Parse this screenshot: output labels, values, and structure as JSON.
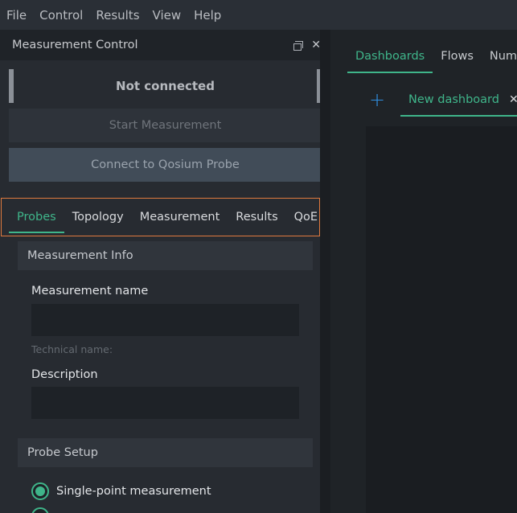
{
  "menu": [
    "File",
    "Control",
    "Results",
    "View",
    "Help"
  ],
  "panel": {
    "title": "Measurement Control",
    "status": "Not connected",
    "start_button": "Start Measurement",
    "connect_button": "Connect to Qosium Probe"
  },
  "tabs": {
    "items": [
      "Probes",
      "Topology",
      "Measurement",
      "Results",
      "QoE"
    ],
    "active": "Probes"
  },
  "measurement_info": {
    "header": "Measurement Info",
    "name_label": "Measurement name",
    "name_value": "",
    "technical_name_hint": "Technical name:",
    "description_label": "Description",
    "description_value": ""
  },
  "probe_setup": {
    "header": "Probe Setup",
    "single_point_label": "Single-point measurement",
    "single_point_checked": true
  },
  "right": {
    "tabs": [
      "Dashboards",
      "Flows",
      "Numeric"
    ],
    "active_tab": "Dashboards",
    "dashboard_tab_label": "New dashboard"
  },
  "colors": {
    "accent": "#3fb58a",
    "highlight_border": "#e07a3f",
    "add_icon": "#2f8fe0"
  },
  "icons": [
    "float-icon",
    "close-icon",
    "add-icon",
    "radio-icon"
  ]
}
